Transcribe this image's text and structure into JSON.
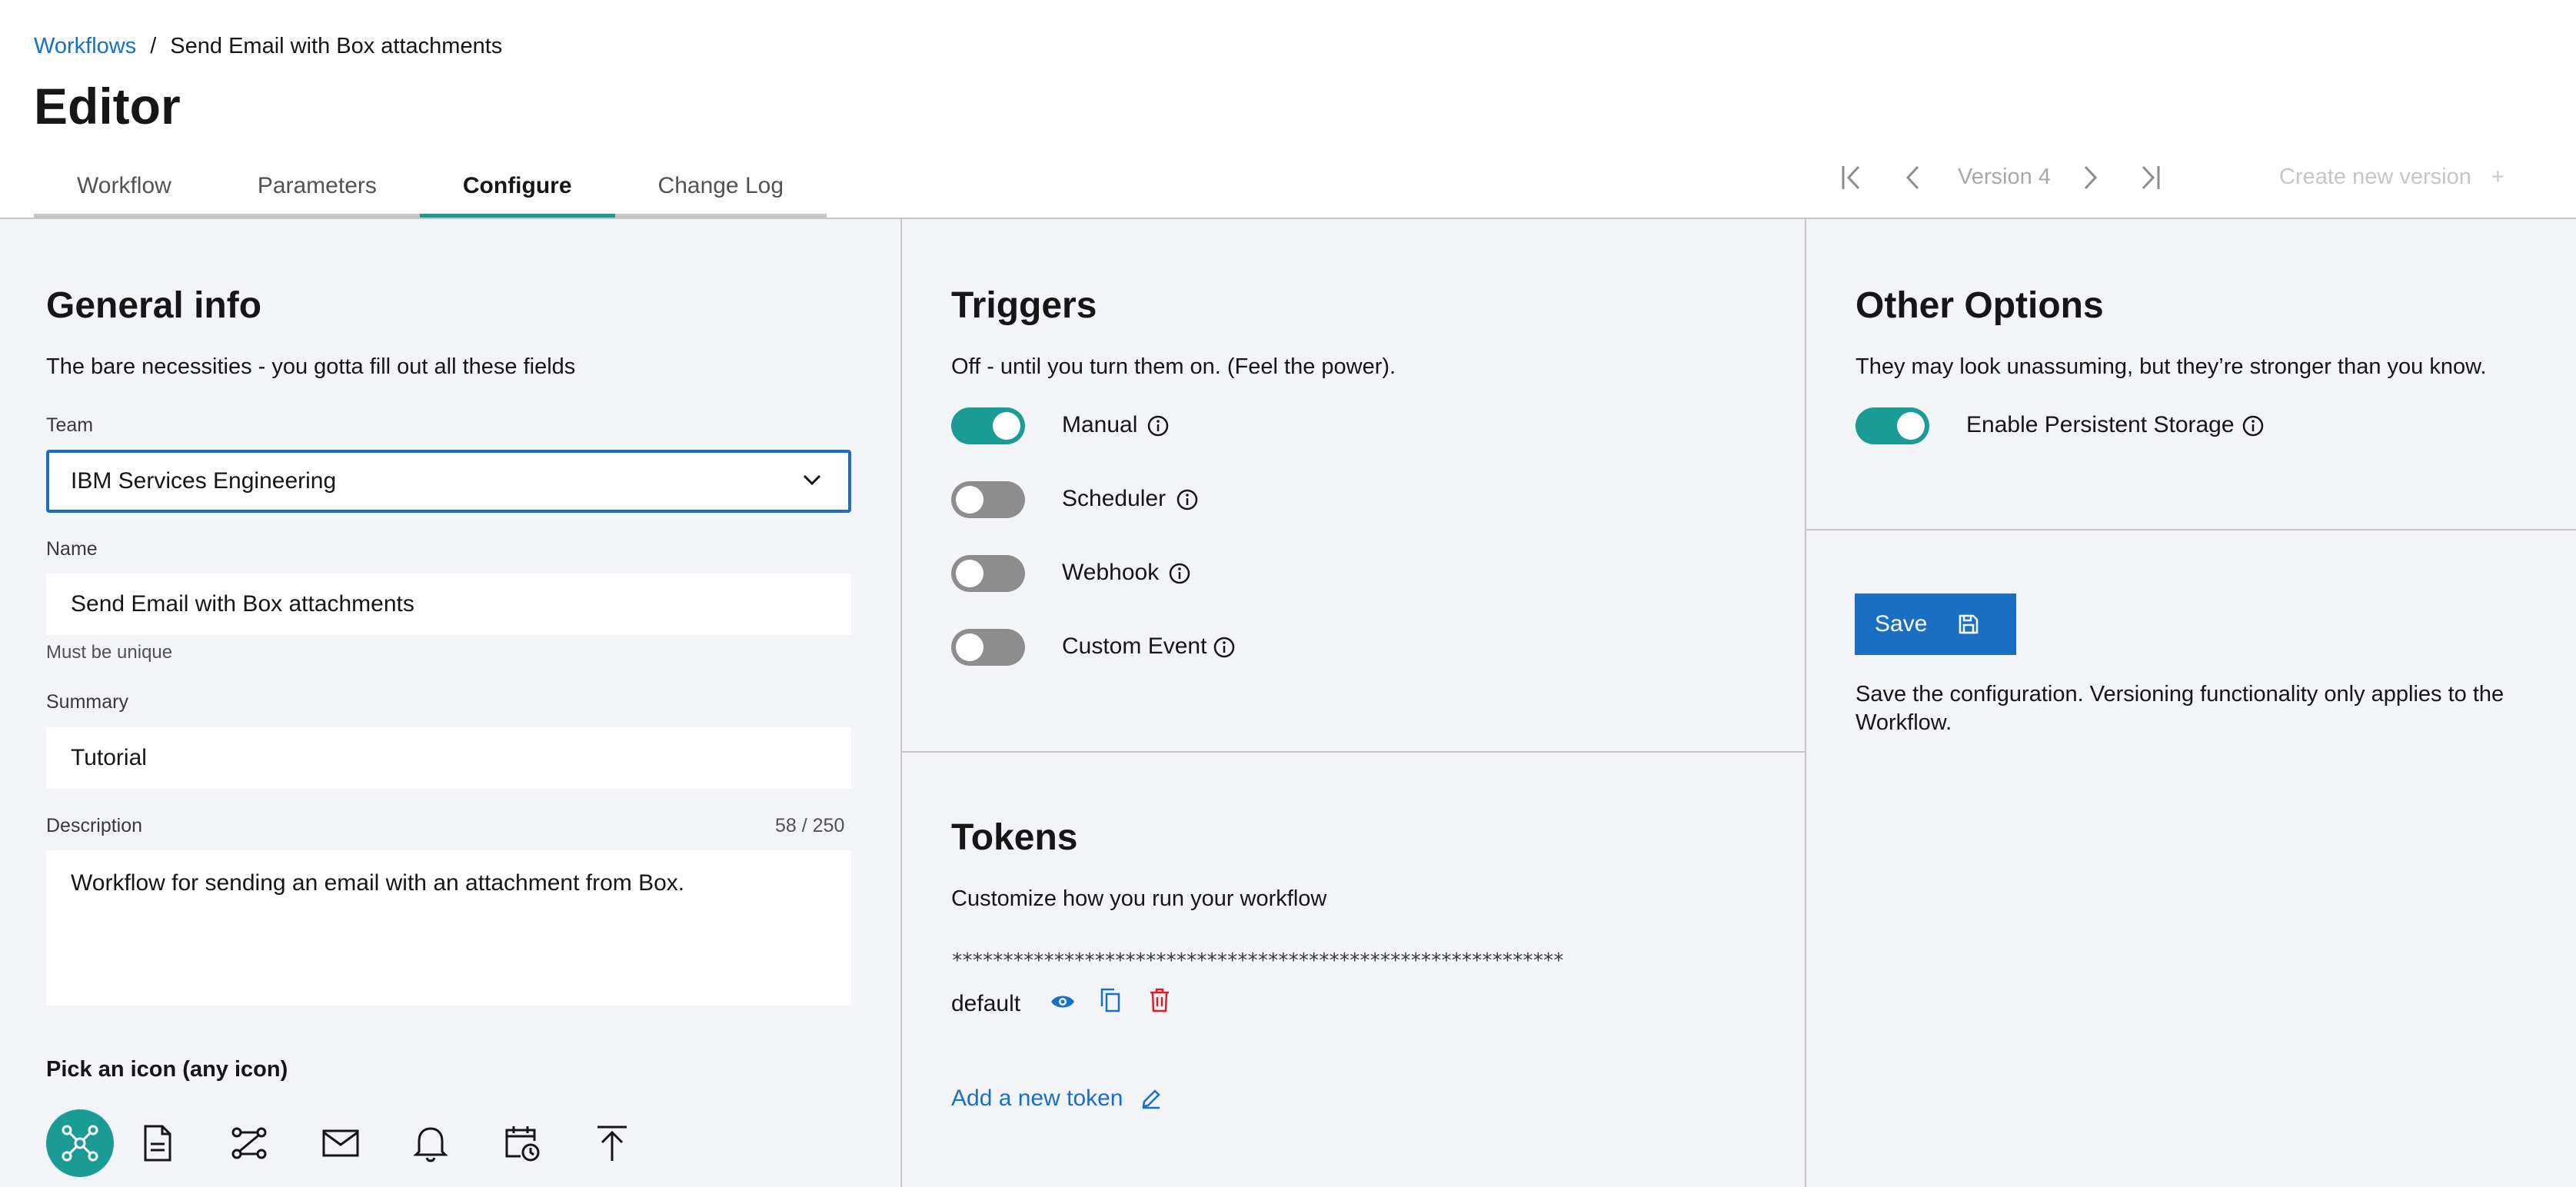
{
  "breadcrumb": {
    "root": "Workflows",
    "separator": "/",
    "current": "Send Email with Box attachments"
  },
  "page": {
    "title": "Editor"
  },
  "tabs": [
    "Workflow",
    "Parameters",
    "Configure",
    "Change Log"
  ],
  "active_tab": "Configure",
  "version_nav": {
    "label": "Version 4",
    "create_label": "Create new version",
    "create_symbol": "+"
  },
  "general": {
    "title": "General info",
    "subtitle": "The bare necessities - you gotta fill out all these fields",
    "team_label": "Team",
    "team_value": "IBM Services Engineering",
    "name_label": "Name",
    "name_value": "Send Email with Box attachments",
    "name_helper": "Must be unique",
    "summary_label": "Summary",
    "summary_value": "Tutorial",
    "description_label": "Description",
    "description_count": "58 / 250",
    "description_value": "Workflow for sending an email with an attachment from Box.",
    "icon_picker_label": "Pick an icon (any icon)",
    "icons": [
      "network-icon",
      "document-icon",
      "flow-icon",
      "email-icon",
      "notification-icon",
      "calendar-clock-icon",
      "upload-icon"
    ]
  },
  "triggers": {
    "title": "Triggers",
    "subtitle": "Off - until you turn them on. (Feel the power).",
    "items": [
      {
        "label": "Manual",
        "enabled": true
      },
      {
        "label": "Scheduler",
        "enabled": false
      },
      {
        "label": "Webhook",
        "enabled": false
      },
      {
        "label": "Custom Event",
        "enabled": false
      }
    ]
  },
  "tokens": {
    "title": "Tokens",
    "subtitle": "Customize how you run your workflow",
    "masked": "************************************************************",
    "token_name": "default",
    "add_label": "Add a new token"
  },
  "other": {
    "title": "Other Options",
    "subtitle": "They may look unassuming, but they’re stronger than you know.",
    "persistent_label": "Enable Persistent Storage",
    "persistent_enabled": true
  },
  "save": {
    "button_label": "Save",
    "description": "Save the configuration. Versioning functionality only applies to the Workflow."
  },
  "colors": {
    "accent_teal": "#1a9b96",
    "primary_blue": "#1a6fc4",
    "danger_red": "#da1e28",
    "panel_bg": "#f2f4f8"
  }
}
